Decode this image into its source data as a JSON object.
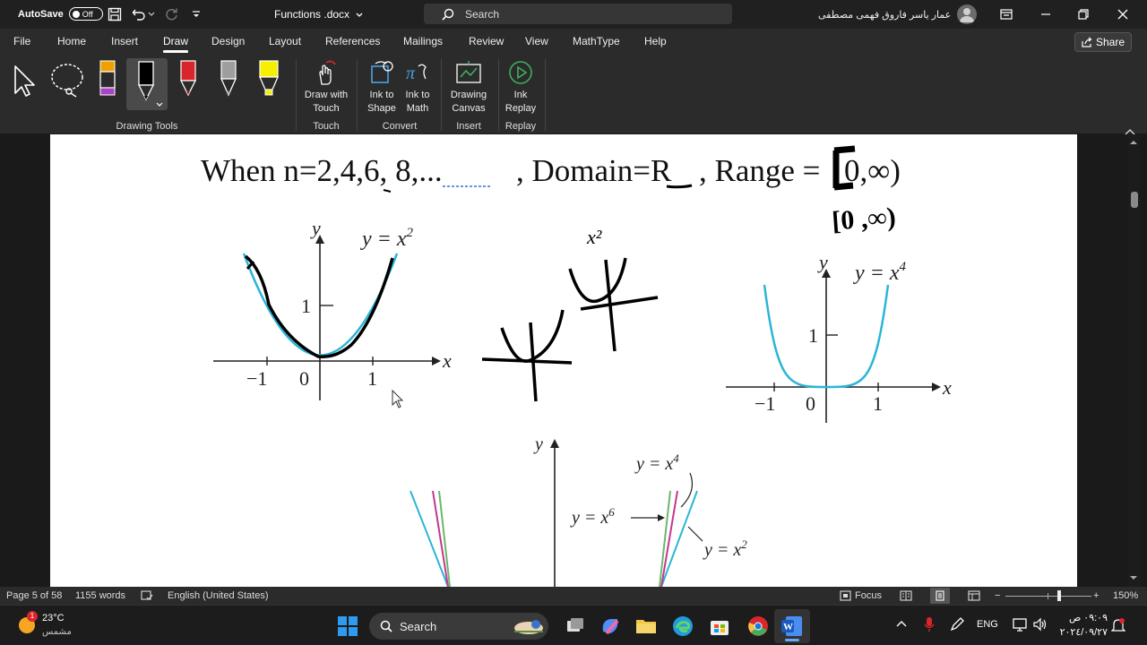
{
  "titlebar": {
    "autosave_label": "AutoSave",
    "autosave_state": "Off",
    "doc_title": "Functions .docx",
    "search_placeholder": "Search",
    "user_name": "عمار ياسر فاروق فهمى مصطفى"
  },
  "menu": {
    "items": [
      "File",
      "Home",
      "Insert",
      "Draw",
      "Design",
      "Layout",
      "References",
      "Mailings",
      "Review",
      "View",
      "MathType",
      "Help"
    ],
    "active": "Draw",
    "share_label": "Share"
  },
  "ribbon": {
    "groups": {
      "drawing_tools": "Drawing Tools",
      "touch": "Touch",
      "convert": "Convert",
      "insert": "Insert",
      "replay": "Replay"
    },
    "buttons": {
      "draw_with_touch": [
        "Draw with",
        "Touch"
      ],
      "ink_to_shape": [
        "Ink to",
        "Shape"
      ],
      "ink_to_math": [
        "Ink to",
        "Math"
      ],
      "drawing_canvas": [
        "Drawing",
        "Canvas"
      ],
      "ink_replay": [
        "Ink",
        "Replay"
      ]
    },
    "pen_colors": [
      "#f0a000",
      "#000000",
      "#d9262c",
      "#9e9e9e",
      "#f7ef00"
    ]
  },
  "document": {
    "heading_text": "When n=2,4,6, 8,...   , Domain=R , Range = [0,∞)",
    "heading_parts": {
      "when": "When n=2,4,6, ",
      "eight": "8,...",
      "domain": ", Domain=",
      "R": "R",
      "range": ", Range = ",
      "bracket": "[",
      "rest": "0,∞)"
    },
    "handwritten_range": "[0 ,∞)",
    "handwritten_x2": "x²",
    "graph1": {
      "eq": "y = x",
      "exp": "2",
      "y": "y",
      "x": "x",
      "ticks": [
        "−1",
        "0",
        "1"
      ],
      "ytick": "1"
    },
    "graph2": {
      "eq": "y = x",
      "exp": "4",
      "y": "y",
      "x": "x",
      "ticks": [
        "−1",
        "0",
        "1"
      ],
      "ytick": "1"
    },
    "graph3": {
      "y": "y",
      "labels": [
        {
          "t": "y = x",
          "e": "4"
        },
        {
          "t": "y = x",
          "e": "6"
        },
        {
          "t": "y = x",
          "e": "2"
        }
      ]
    }
  },
  "status": {
    "page": "Page 5 of 58",
    "words": "1155 words",
    "language": "English (United States)",
    "focus": "Focus",
    "zoom": "150%",
    "zoom_level": 0.62
  },
  "taskbar": {
    "weather_temp": "23°C",
    "weather_desc": "مشمس",
    "search_label": "Search",
    "lang": "ENG",
    "time": "٠٩:٠٩ ص",
    "date": "٢٠٢٤/٠٩/٢٧",
    "notif_count": "1"
  }
}
